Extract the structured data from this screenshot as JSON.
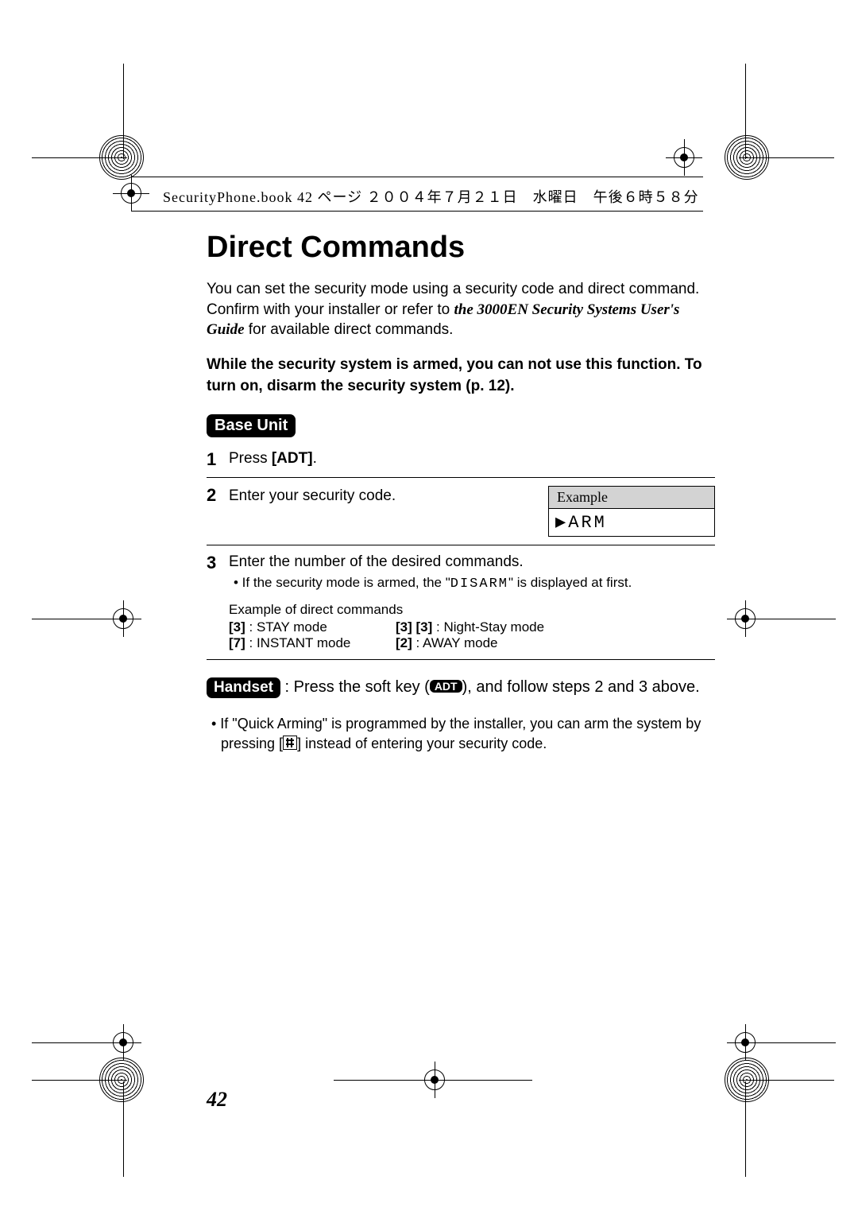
{
  "header_crop_text": "SecurityPhone.book  42 ページ  ２００４年７月２１日　水曜日　午後６時５８分",
  "title": "Direct Commands",
  "intro_part1": "You can set the security mode using a security code and direct command. Confirm with your installer or refer to ",
  "intro_italic": "the 3000EN Security Systems User's Guide",
  "intro_part2": " for available direct commands.",
  "warning": "While the security system is armed, you can not use this function. To turn on, disarm the security system (p. 12).",
  "base_unit_label": "Base Unit",
  "step1_num": "1",
  "step1_a": "Press ",
  "step1_b": "[ADT]",
  "step1_c": ".",
  "step2_num": "2",
  "step2_text": "Enter your security code.",
  "example_label": "Example",
  "example_screen": "▶ARM",
  "step3_num": "3",
  "step3_text": "Enter the number of the desired commands.",
  "step3_sub_a": "• If the security mode is armed, the \"",
  "step3_sub_mono": "DISARM",
  "step3_sub_b": "\" is displayed at first.",
  "ex_cmds_title": "Example of direct commands",
  "cmd_3_k": "[3]",
  "cmd_3_v": " : STAY mode",
  "cmd_33_k": "[3] [3]",
  "cmd_33_v": " : Night-Stay mode",
  "cmd_7_k": "[7]",
  "cmd_7_v": " : INSTANT mode",
  "cmd_2_k": "[2]",
  "cmd_2_v": " : AWAY mode",
  "handset_label": "Handset",
  "handset_a": " : Press the soft key (",
  "handset_pill": "ADT",
  "handset_b": "), and follow steps 2 and 3 above.",
  "footnote_a": "• If \"Quick Arming\" is programmed by the installer, you can arm the system by pressing ",
  "footnote_key_l": "[",
  "footnote_key_r": "]",
  "footnote_b": " instead of entering your security code.",
  "page_number": "42"
}
